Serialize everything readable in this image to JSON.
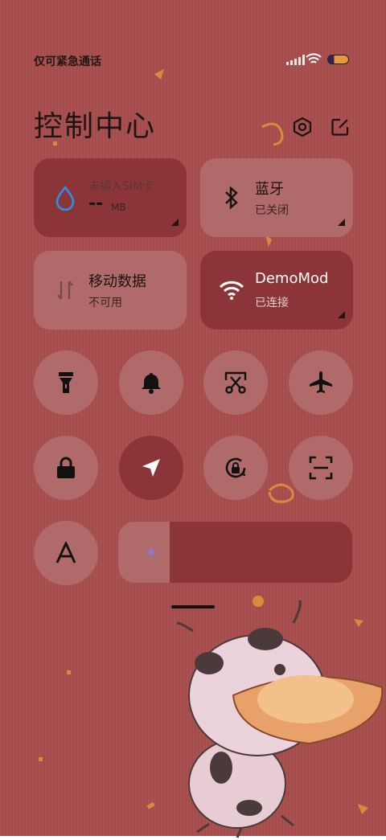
{
  "status_bar": {
    "carrier_text": "仅可紧急通话",
    "battery_colors": [
      "#3a2250",
      "#e79a3c"
    ]
  },
  "header": {
    "title": "控制中心",
    "settings_icon": "hexagon-gear-icon",
    "edit_icon": "edit-pencil-icon"
  },
  "tiles": {
    "sim": {
      "label": "未插入SIM卡",
      "value": "--",
      "unit": "MB",
      "icon": "water-drop-icon"
    },
    "bluetooth": {
      "label": "蓝牙",
      "status": "已关闭",
      "icon": "bluetooth-icon"
    },
    "mobile_data": {
      "label": "移动数据",
      "status": "不可用",
      "icon": "data-arrows-icon"
    },
    "wifi": {
      "label": "DemoMod",
      "status": "已连接",
      "icon": "wifi-icon"
    }
  },
  "toggles": [
    {
      "name": "flashlight",
      "icon": "flashlight-icon",
      "on": false
    },
    {
      "name": "ringer",
      "icon": "bell-icon",
      "on": false
    },
    {
      "name": "screenshot",
      "icon": "scissors-icon",
      "on": false
    },
    {
      "name": "airplane",
      "icon": "airplane-icon",
      "on": false
    },
    {
      "name": "lock-screen",
      "icon": "lock-icon",
      "on": false
    },
    {
      "name": "location",
      "icon": "location-arrow-icon",
      "on": true
    },
    {
      "name": "rotation-lock",
      "icon": "rotation-lock-icon",
      "on": false
    },
    {
      "name": "scanner",
      "icon": "scan-icon",
      "on": false
    },
    {
      "name": "font-size",
      "icon": "letter-a-icon",
      "on": false
    }
  ],
  "brightness": {
    "level": 0.22,
    "icon": "sun-icon"
  },
  "colors": {
    "background": "#a84e4e",
    "tile_dark": "#8b3538",
    "tile_light": "#b06a6a",
    "accent_blue": "#2e8fe6"
  }
}
